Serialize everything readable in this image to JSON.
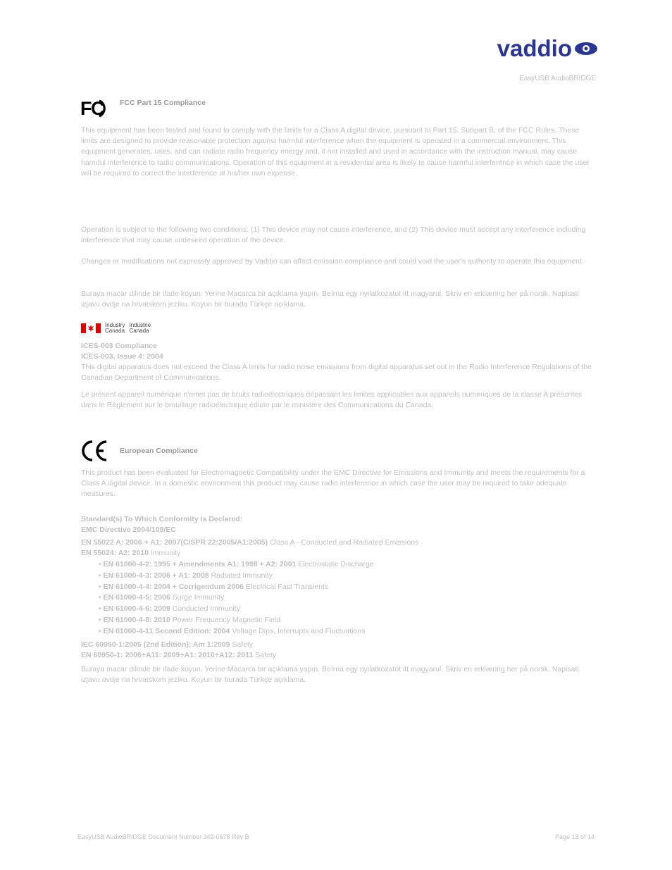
{
  "header": {
    "logo_text": "vaddio",
    "product_name": "EasyUSB AudioBRIDGE"
  },
  "fcc": {
    "title": "FCC Part 15 Compliance",
    "para1": "This equipment has been tested and found to comply with the limits for a Class A digital device, pursuant to Part 15, Subpart B, of the FCC Rules. These limits are designed to provide reasonable protection against harmful interference when the equipment is operated in a commercial environment. This equipment generates, uses, and can radiate radio frequency energy and, if not installed and used in accordance with the instruction manual, may cause harmful interference to radio communications. Operation of this equipment in a residential area is likely to cause harmful interference in which case the user will be required to correct the interference at his/her own expense.",
    "para2": "Operation is subject to the following two conditions: (1) This device may not cause interference, and (2) This device must accept any interference including interference that may cause undesired operation of the device.",
    "para3": "Changes or modifications not expressly approved by Vaddio can affect emission compliance and could void the user's authority to operate this equipment."
  },
  "ices": {
    "logo_en": "Industry",
    "logo_en2": "Canada",
    "logo_fr": "Industrie",
    "logo_fr2": "Canada",
    "title": "ICES-003 Compliance",
    "subtitle": "ICES-003, Issue 4: 2004",
    "para_en": "This digital apparatus does not exceed the Class A limits for radio noise emissions from digital apparatus set out in the Radio Interference Regulations of the Canadian Department of Communications.",
    "para_fr": "Le présent appareil numérique n'emet pas de bruits radioélectriques dépassant les limites applicables aux appareils numeriques de la classe A préscrites dans le Règlement sur le brouillage radioélectrique édicte par le ministère des Communications du Canada."
  },
  "ce": {
    "title": "European Compliance",
    "para1": "This product has been evaluated for Electromagnetic Compatibility under the EMC Directive for Emissions and Immunity and meets the requirements for a Class A digital device. In a domestic environment this product may cause radio interference in which case the user may be required to take adequate measures.",
    "standards_title": "Standard(s) To Which Conformity Is Declared:",
    "emc": "EMC Directive 2004/108/EC",
    "std1_title": "EN 55022 A: 2006 + A1: 2007(CISPR 22:2005/A1:2005)",
    "std1_desc": "Class A - Conducted and Radiated Emissions",
    "std2_title": "EN 55024: A2: 2010",
    "std2_desc": "Immunity",
    "item1_title": "EN 61000-4-2: 1995 + Amendments A1: 1998 + A2: 2001",
    "item1_desc": "Electrostatic Discharge",
    "item2_title": "EN 61000-4-3: 2006 + A1: 2008",
    "item2_desc": "Radiated Immunity",
    "item3_title": "EN 61000-4-4: 2004 + Corrigendum 2006",
    "item3_desc": "Electrical Fast Transients",
    "item4_title": "EN 61000-4-5: 2006",
    "item4_desc": "Surge Immunity",
    "item5_title": "EN 61000-4-6: 2009",
    "item5_desc": "Conducted Immunity",
    "item6_title": "EN 61000-4-8: 2010",
    "item6_desc": "Power Frequency Magnetic Field",
    "item7_title": "EN 61000-4-11 Second Edition: 2004",
    "item7_desc": "Voltage Dips, Interrupts and Fluctuations",
    "iec1": "IEC 60950-1:2005 (2nd Edition); Am 1:2009",
    "iec1_desc": "Safety",
    "iec2": "EN 60950-1: 2006+A11: 2009+A1: 2010+A12: 2011",
    "iec2_desc": "Safety"
  },
  "langs": {
    "p1": "Buraya macar dilinde bir ifade koyun. Yerine Macarca bir açıklama yapın. Beírna egy nyilatkozatot itt magyarul. Skriv en erklæring her på norsk. Napisati izjavu ovdje na hrvatskom jeziku. Koyun bir burada Türkçe açıklama."
  },
  "footer": {
    "left": "EasyUSB AudioBRIDGE Document Number 342-0678 Rev B",
    "right": "Page 13 of 14"
  }
}
